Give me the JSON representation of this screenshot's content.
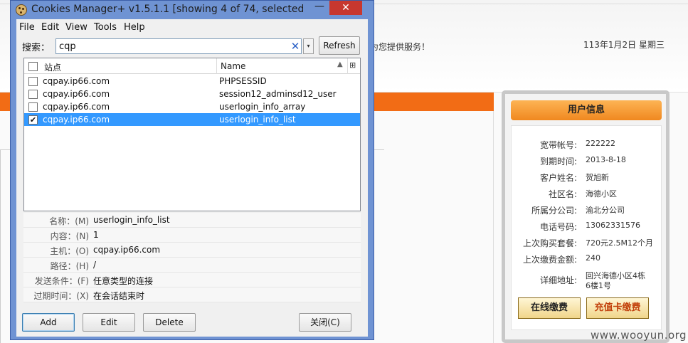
{
  "background_page": {
    "welcome_fragment": "为您提供服务！",
    "date": "113年1月2日  星期三",
    "user_info": {
      "title": "用户信息",
      "rows": [
        {
          "label": "宽带帐号:",
          "value": "222222"
        },
        {
          "label": "到期时间:",
          "value": "2013-8-18"
        },
        {
          "label": "客户姓名:",
          "value": "贺旭新"
        },
        {
          "label": "社区名:",
          "value": "海德小区"
        },
        {
          "label": "所属分公司:",
          "value": "渝北分公司"
        },
        {
          "label": "电话号码:",
          "value": "13062331576"
        },
        {
          "label": "上次购买套餐:",
          "value": "720元2.5M12个月"
        },
        {
          "label": "上次缴费金额:",
          "value": "240"
        },
        {
          "label": "详细地址:",
          "value": "回兴海德小区4栋6楼1号"
        }
      ],
      "pay_online": "在线缴费",
      "card_pay": "充值卡缴费"
    },
    "watermark": "www.wooyun.org"
  },
  "dialog": {
    "title": "Cookies Manager+ v1.5.1.1 [showing 4 of 74, selected 1]",
    "minimize_glyph": "—",
    "close_glyph": "✕",
    "menu": [
      "File",
      "Edit",
      "View",
      "Tools",
      "Help"
    ],
    "search": {
      "label": "搜索：",
      "value": "cqp",
      "clear_glyph": "✕",
      "dropdown_glyph": "▾"
    },
    "refresh_label": "Refresh",
    "columns": {
      "site": "站点",
      "name": "Name",
      "sort_glyph": "▲",
      "picker_glyph": "⊞"
    },
    "rows": [
      {
        "checked": false,
        "selected": false,
        "site": "cqpay.ip66.com",
        "name": "PHPSESSID"
      },
      {
        "checked": false,
        "selected": false,
        "site": "cqpay.ip66.com",
        "name": "session12_adminsd12_user"
      },
      {
        "checked": false,
        "selected": false,
        "site": "cqpay.ip66.com",
        "name": "userlogin_info_array"
      },
      {
        "checked": true,
        "selected": true,
        "site": "cqpay.ip66.com",
        "name": "userlogin_info_list"
      }
    ],
    "details": [
      {
        "label": "名称：(M)",
        "value": "userlogin_info_list"
      },
      {
        "label": "内容：(N)",
        "value": "1"
      },
      {
        "label": "主机：(O)",
        "value": "cqpay.ip66.com"
      },
      {
        "label": "路径：(H)",
        "value": "/"
      },
      {
        "label": "发送条件：(F)",
        "value": "任意类型的连接"
      },
      {
        "label": "过期时间：(X)",
        "value": "在会话结束时"
      }
    ],
    "buttons": {
      "add": "Add",
      "edit": "Edit",
      "delete": "Delete",
      "close": "关闭(C)"
    }
  }
}
